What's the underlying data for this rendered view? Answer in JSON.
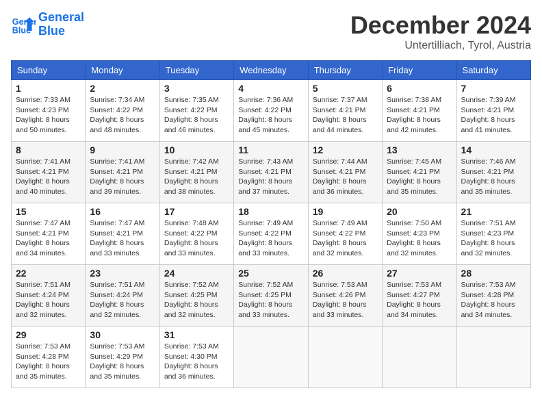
{
  "header": {
    "logo_line1": "General",
    "logo_line2": "Blue",
    "month_year": "December 2024",
    "location": "Untertilliach, Tyrol, Austria"
  },
  "days_of_week": [
    "Sunday",
    "Monday",
    "Tuesday",
    "Wednesday",
    "Thursday",
    "Friday",
    "Saturday"
  ],
  "weeks": [
    [
      {
        "day": "1",
        "sunrise": "7:33 AM",
        "sunset": "4:23 PM",
        "daylight": "8 hours and 50 minutes."
      },
      {
        "day": "2",
        "sunrise": "7:34 AM",
        "sunset": "4:22 PM",
        "daylight": "8 hours and 48 minutes."
      },
      {
        "day": "3",
        "sunrise": "7:35 AM",
        "sunset": "4:22 PM",
        "daylight": "8 hours and 46 minutes."
      },
      {
        "day": "4",
        "sunrise": "7:36 AM",
        "sunset": "4:22 PM",
        "daylight": "8 hours and 45 minutes."
      },
      {
        "day": "5",
        "sunrise": "7:37 AM",
        "sunset": "4:21 PM",
        "daylight": "8 hours and 44 minutes."
      },
      {
        "day": "6",
        "sunrise": "7:38 AM",
        "sunset": "4:21 PM",
        "daylight": "8 hours and 42 minutes."
      },
      {
        "day": "7",
        "sunrise": "7:39 AM",
        "sunset": "4:21 PM",
        "daylight": "8 hours and 41 minutes."
      }
    ],
    [
      {
        "day": "8",
        "sunrise": "7:41 AM",
        "sunset": "4:21 PM",
        "daylight": "8 hours and 40 minutes."
      },
      {
        "day": "9",
        "sunrise": "7:41 AM",
        "sunset": "4:21 PM",
        "daylight": "8 hours and 39 minutes."
      },
      {
        "day": "10",
        "sunrise": "7:42 AM",
        "sunset": "4:21 PM",
        "daylight": "8 hours and 38 minutes."
      },
      {
        "day": "11",
        "sunrise": "7:43 AM",
        "sunset": "4:21 PM",
        "daylight": "8 hours and 37 minutes."
      },
      {
        "day": "12",
        "sunrise": "7:44 AM",
        "sunset": "4:21 PM",
        "daylight": "8 hours and 36 minutes."
      },
      {
        "day": "13",
        "sunrise": "7:45 AM",
        "sunset": "4:21 PM",
        "daylight": "8 hours and 35 minutes."
      },
      {
        "day": "14",
        "sunrise": "7:46 AM",
        "sunset": "4:21 PM",
        "daylight": "8 hours and 35 minutes."
      }
    ],
    [
      {
        "day": "15",
        "sunrise": "7:47 AM",
        "sunset": "4:21 PM",
        "daylight": "8 hours and 34 minutes."
      },
      {
        "day": "16",
        "sunrise": "7:47 AM",
        "sunset": "4:21 PM",
        "daylight": "8 hours and 33 minutes."
      },
      {
        "day": "17",
        "sunrise": "7:48 AM",
        "sunset": "4:22 PM",
        "daylight": "8 hours and 33 minutes."
      },
      {
        "day": "18",
        "sunrise": "7:49 AM",
        "sunset": "4:22 PM",
        "daylight": "8 hours and 33 minutes."
      },
      {
        "day": "19",
        "sunrise": "7:49 AM",
        "sunset": "4:22 PM",
        "daylight": "8 hours and 32 minutes."
      },
      {
        "day": "20",
        "sunrise": "7:50 AM",
        "sunset": "4:23 PM",
        "daylight": "8 hours and 32 minutes."
      },
      {
        "day": "21",
        "sunrise": "7:51 AM",
        "sunset": "4:23 PM",
        "daylight": "8 hours and 32 minutes."
      }
    ],
    [
      {
        "day": "22",
        "sunrise": "7:51 AM",
        "sunset": "4:24 PM",
        "daylight": "8 hours and 32 minutes."
      },
      {
        "day": "23",
        "sunrise": "7:51 AM",
        "sunset": "4:24 PM",
        "daylight": "8 hours and 32 minutes."
      },
      {
        "day": "24",
        "sunrise": "7:52 AM",
        "sunset": "4:25 PM",
        "daylight": "8 hours and 32 minutes."
      },
      {
        "day": "25",
        "sunrise": "7:52 AM",
        "sunset": "4:25 PM",
        "daylight": "8 hours and 33 minutes."
      },
      {
        "day": "26",
        "sunrise": "7:53 AM",
        "sunset": "4:26 PM",
        "daylight": "8 hours and 33 minutes."
      },
      {
        "day": "27",
        "sunrise": "7:53 AM",
        "sunset": "4:27 PM",
        "daylight": "8 hours and 34 minutes."
      },
      {
        "day": "28",
        "sunrise": "7:53 AM",
        "sunset": "4:28 PM",
        "daylight": "8 hours and 34 minutes."
      }
    ],
    [
      {
        "day": "29",
        "sunrise": "7:53 AM",
        "sunset": "4:28 PM",
        "daylight": "8 hours and 35 minutes."
      },
      {
        "day": "30",
        "sunrise": "7:53 AM",
        "sunset": "4:29 PM",
        "daylight": "8 hours and 35 minutes."
      },
      {
        "day": "31",
        "sunrise": "7:53 AM",
        "sunset": "4:30 PM",
        "daylight": "8 hours and 36 minutes."
      },
      null,
      null,
      null,
      null
    ]
  ],
  "labels": {
    "sunrise_prefix": "Sunrise: ",
    "sunset_prefix": "Sunset: ",
    "daylight_prefix": "Daylight: "
  }
}
